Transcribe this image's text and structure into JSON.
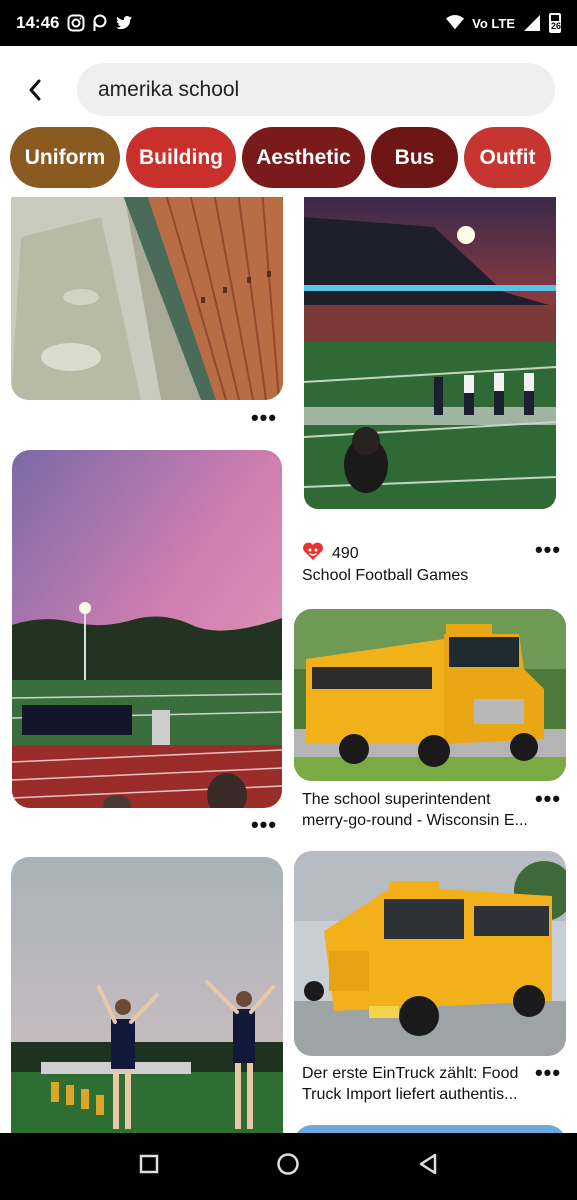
{
  "status_bar": {
    "time": "14:46",
    "battery_level": "26",
    "network_label": "Vo LTE"
  },
  "search": {
    "query": "amerika school"
  },
  "chips": [
    {
      "label": "Uniform",
      "color": "#8a5a20"
    },
    {
      "label": "Building",
      "color": "#c9302c"
    },
    {
      "label": "Aesthetic",
      "color": "#7a1a1a"
    },
    {
      "label": "Bus",
      "color": "#6e1616"
    },
    {
      "label": "Outfit",
      "color": "#c63531"
    }
  ],
  "pins": [
    {
      "id": "hallway-lockers",
      "title": ""
    },
    {
      "id": "football-stadium",
      "reaction_count": "490",
      "title": "School Football Games"
    },
    {
      "id": "sunset-field",
      "title": ""
    },
    {
      "id": "school-bus-1",
      "title": "The school superintendent merry-go-round - Wisconsin E..."
    },
    {
      "id": "cheerleaders",
      "title": ""
    },
    {
      "id": "school-bus-2",
      "title": "Der erste EinTruck zählt: Food Truck Import liefert authentis..."
    }
  ],
  "more_label": "•••"
}
